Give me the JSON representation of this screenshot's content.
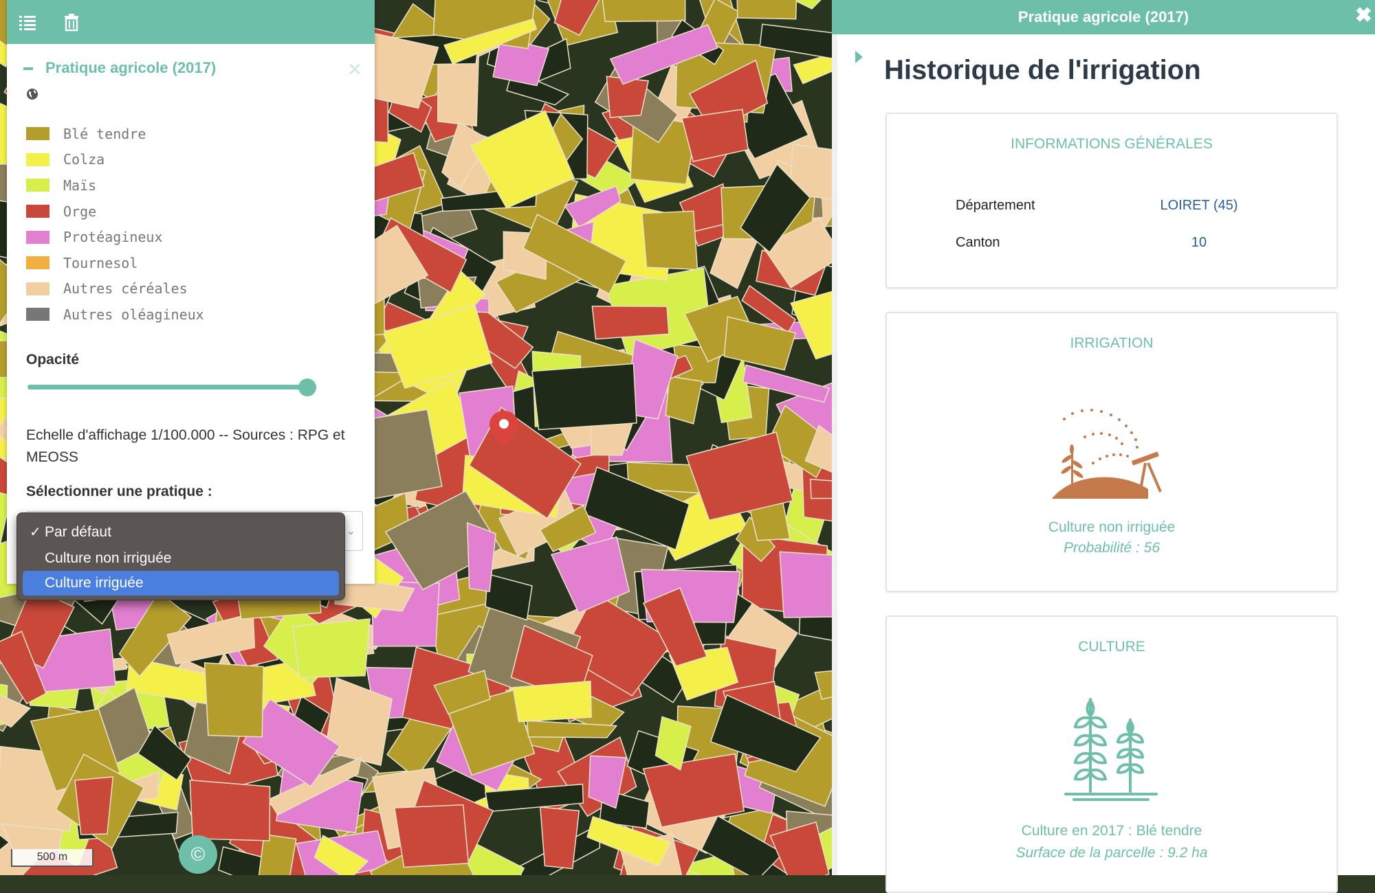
{
  "left_panel": {
    "layer_title": "Pratique agricole (2017)",
    "legend": [
      {
        "label": "Blé tendre",
        "color": "#b59d2c"
      },
      {
        "label": "Colza",
        "color": "#f5ef4a"
      },
      {
        "label": "Maïs",
        "color": "#d7ef4a"
      },
      {
        "label": "Orge",
        "color": "#c9483a"
      },
      {
        "label": "Protéagineux",
        "color": "#e27fd0"
      },
      {
        "label": "Tournesol",
        "color": "#f0b040"
      },
      {
        "label": "Autres céréales",
        "color": "#f2cfa2"
      },
      {
        "label": "Autres oléagineux",
        "color": "#777777"
      }
    ],
    "opacity_label": "Opacité",
    "opacity_value": 0.97,
    "scale_note": "Echelle d'affichage 1/100.000 -- Sources : RPG et MEOSS",
    "select_label": "Sélectionner une pratique :",
    "options": [
      "Par défaut",
      "Culture non irriguée",
      "Culture irriguée"
    ],
    "checked_option": "Par défaut",
    "highlighted_option": "Culture irriguée"
  },
  "right_panel": {
    "header": "Pratique agricole (2017)",
    "title": "Historique de l'irrigation",
    "general_card": {
      "title": "INFORMATIONS GÉNÉRALES",
      "rows": [
        {
          "label": "Département",
          "value": "LOIRET (45)"
        },
        {
          "label": "Canton",
          "value": "10"
        }
      ]
    },
    "irrigation_card": {
      "title": "IRRIGATION",
      "caption": "Culture non irriguée",
      "sub": "Probabilité : 56"
    },
    "culture_card": {
      "title": "CULTURE",
      "caption": "Culture en 2017 : Blé tendre",
      "sub": "Surface de la parcelle : 9.2 ha"
    }
  },
  "map": {
    "scale_text": "500 m",
    "attribution_symbol": "©"
  },
  "colors": {
    "accent": "#6dbfaa",
    "title_dark": "#2d3a48",
    "link_blue": "#2a5f9e",
    "pin_red": "#d9443c"
  }
}
